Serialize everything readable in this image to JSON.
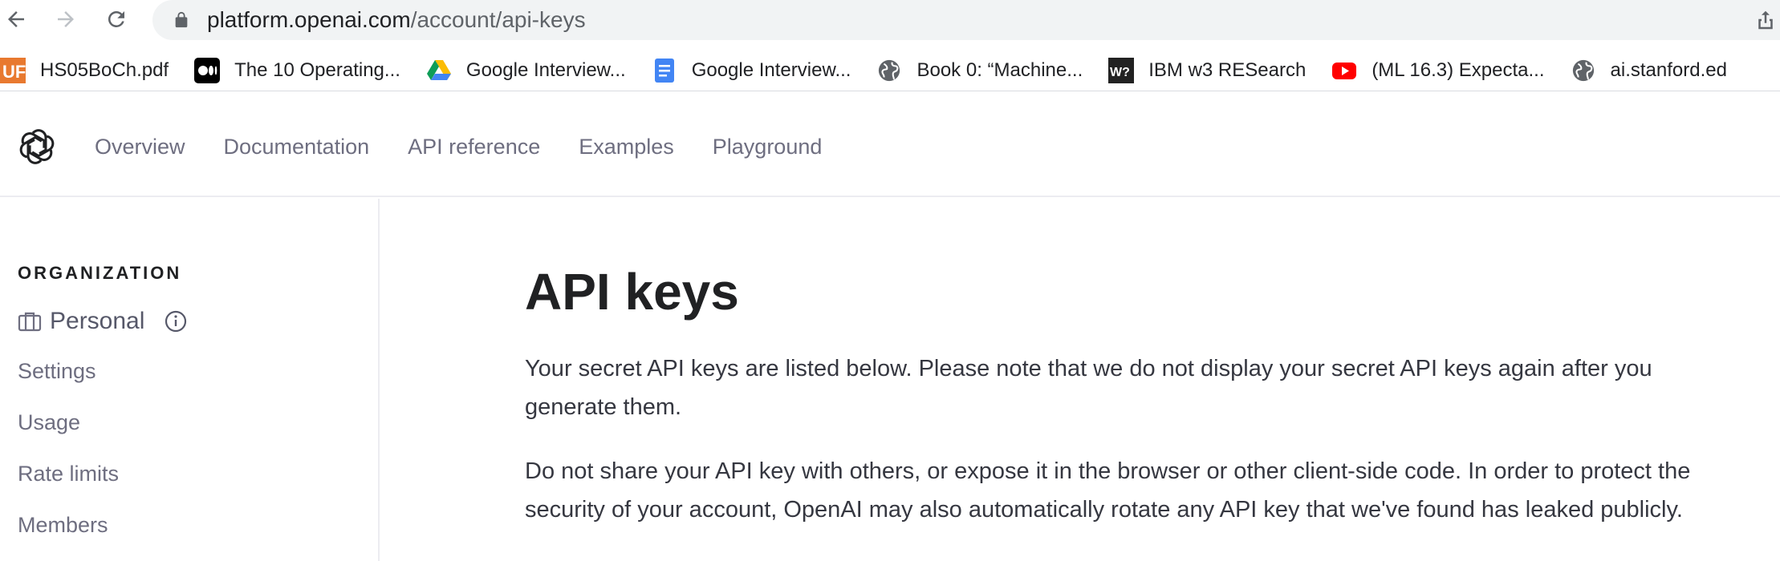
{
  "browser": {
    "url_domain": "platform.openai.com",
    "url_path": "/account/api-keys",
    "bookmarks": [
      {
        "label": "HS05BoCh.pdf",
        "icon": "uf-icon"
      },
      {
        "label": "The 10 Operating...",
        "icon": "medium-icon"
      },
      {
        "label": "Google Interview...",
        "icon": "google-drive-icon"
      },
      {
        "label": "Google Interview...",
        "icon": "google-docs-icon"
      },
      {
        "label": "Book 0: “Machine...",
        "icon": "globe-icon"
      },
      {
        "label": "IBM w3 RESearch",
        "icon": "wp-icon"
      },
      {
        "label": "(ML 16.3) Expecta...",
        "icon": "youtube-icon"
      },
      {
        "label": "ai.stanford.ed",
        "icon": "globe-icon"
      }
    ]
  },
  "header": {
    "nav": [
      "Overview",
      "Documentation",
      "API reference",
      "Examples",
      "Playground"
    ]
  },
  "sidebar": {
    "heading": "ORGANIZATION",
    "org_name": "Personal",
    "links": [
      "Settings",
      "Usage",
      "Rate limits",
      "Members"
    ]
  },
  "main": {
    "title": "API keys",
    "paragraph1": "Your secret API keys are listed below. Please note that we do not display your secret API keys again after you generate them.",
    "paragraph2": "Do not share your API key with others, or expose it in the browser or other client-side code. In order to protect the security of your account, OpenAI may also automatically rotate any API key that we've found has leaked publicly."
  },
  "colors": {
    "nav_text": "#6e6e80",
    "heading_text": "#202123",
    "body_text": "#353740",
    "omnibox_bg": "#f1f3f4"
  }
}
